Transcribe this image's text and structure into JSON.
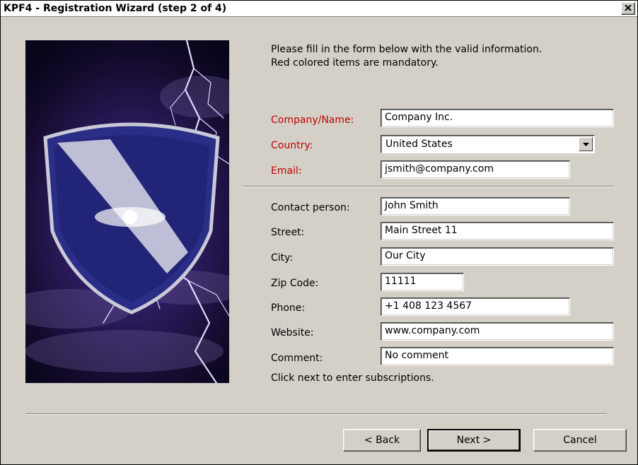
{
  "window": {
    "title": "KPF4 - Registration Wizard (step 2 of 4)"
  },
  "intro": {
    "line1": "Please fill in the form below with the valid information.",
    "line2": "Red colored items are mandatory."
  },
  "required_color": "#c00000",
  "form": {
    "company": {
      "label": "Company/Name:",
      "value": "Company Inc."
    },
    "country": {
      "label": "Country:",
      "value": "United States"
    },
    "email": {
      "label": "Email:",
      "value": "jsmith@company.com"
    },
    "contact": {
      "label": "Contact person:",
      "value": "John Smith"
    },
    "street": {
      "label": "Street:",
      "value": "Main Street 11"
    },
    "city": {
      "label": "City:",
      "value": "Our City"
    },
    "zip": {
      "label": "Zip Code:",
      "value": "11111"
    },
    "phone": {
      "label": "Phone:",
      "value": "+1 408 123 4567"
    },
    "website": {
      "label": "Website:",
      "value": "www.company.com"
    },
    "comment": {
      "label": "Comment:",
      "value": "No comment"
    }
  },
  "footer_text": "Click next to enter subscriptions.",
  "buttons": {
    "back": "< Back",
    "next": "Next >",
    "cancel": "Cancel"
  },
  "icons": {
    "close": "close-icon",
    "dropdown": "chevron-down-icon",
    "artwork": "shield-lightning-image"
  }
}
